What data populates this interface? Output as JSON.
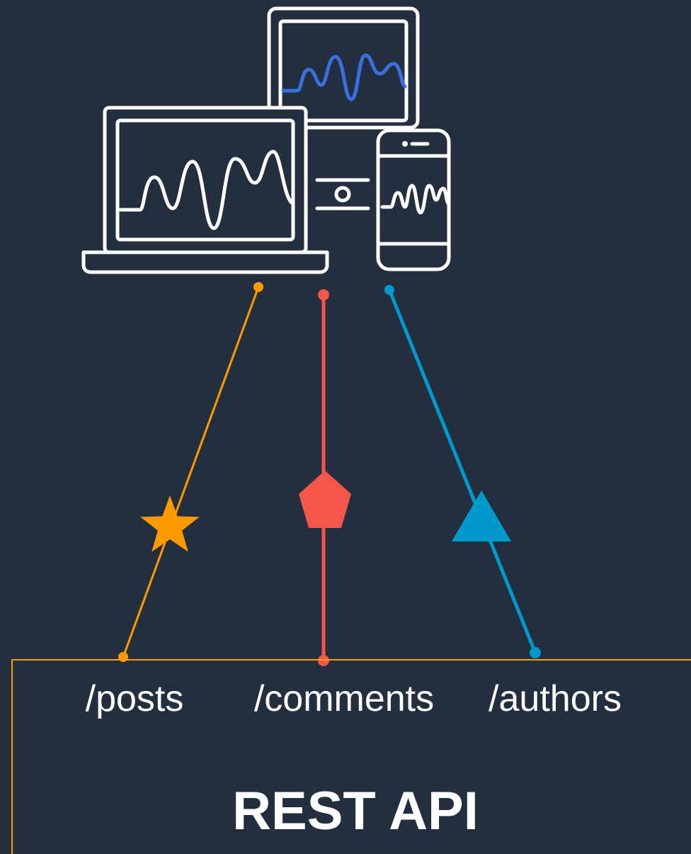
{
  "colors": {
    "background": "#232f3e",
    "device_outline": "#ffffff",
    "tablet_wave": "#3b6fe0",
    "posts": "#f90",
    "comments": "#f5564a",
    "authors": "#0099cc"
  },
  "api": {
    "title": "REST API"
  },
  "endpoints": [
    {
      "label": "/posts",
      "marker": "star-icon"
    },
    {
      "label": "/comments",
      "marker": "pentagon-icon"
    },
    {
      "label": "/authors",
      "marker": "triangle-icon"
    }
  ]
}
